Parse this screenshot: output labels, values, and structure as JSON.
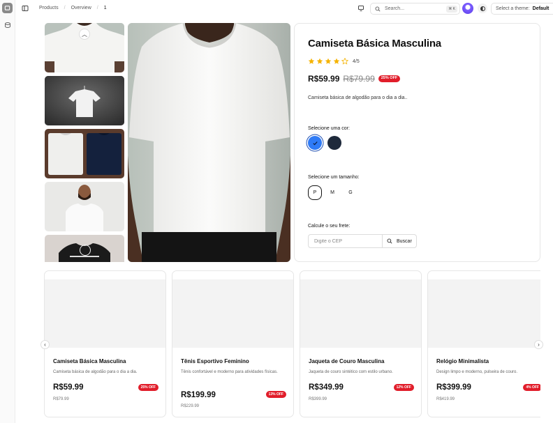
{
  "breadcrumb": [
    "Products",
    "Overview",
    "1"
  ],
  "search": {
    "placeholder": "Search...",
    "shortcut": "⌘ K"
  },
  "theme": {
    "label": "Select a theme:",
    "value": "Default"
  },
  "product": {
    "title": "Camiseta Básica Masculina",
    "rating": 4,
    "rating_text": "4/5",
    "price": "R$59.99",
    "old_price": "R$79.99",
    "discount": "25% OFF",
    "description": "Camiseta básica de algodão para o dia a dia..",
    "color_label": "Selecione uma cor:",
    "colors": [
      "#2f7bf6",
      "#1e293b"
    ],
    "size_label": "Selecione um tamanho:",
    "sizes": [
      "P",
      "M",
      "G"
    ],
    "selected_size": "P",
    "shipping_label": "Calcule o seu frete:",
    "cep_placeholder": "Digite o CEP",
    "search_button": "Buscar"
  },
  "related": [
    {
      "name": "Camiseta Básica Masculina",
      "desc": "Camiseta básica de algodão para o dia a dia.",
      "price": "R$59.99",
      "old_price": "R$79.99",
      "discount": "25% OFF"
    },
    {
      "name": "Tênis Esportivo Feminino",
      "desc": "Tênis confortável e moderno para atividades físicas.",
      "price": "R$199.99",
      "old_price": "R$229.99",
      "discount": "13% OFF"
    },
    {
      "name": "Jaqueta de Couro Masculina",
      "desc": "Jaqueta de couro sintético com estilo urbano.",
      "price": "R$349.99",
      "old_price": "R$399.99",
      "discount": "12% OFF"
    },
    {
      "name": "Relógio Minimalista",
      "desc": "Design limpo e moderno, pulseira de couro.",
      "price": "R$399.99",
      "old_price": "R$419.99",
      "discount": "4% OFF"
    }
  ],
  "colors": {
    "accent": "#e11d2a",
    "star": "#f5b301"
  }
}
